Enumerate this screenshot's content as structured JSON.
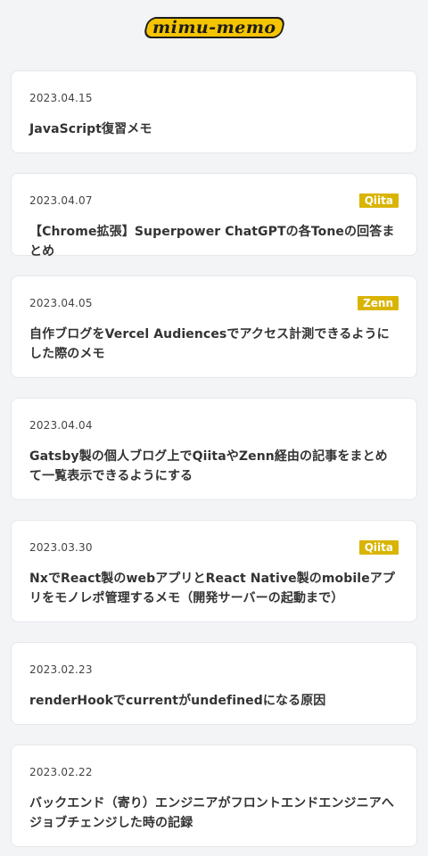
{
  "header": {
    "logo_text": "mimu-memo"
  },
  "posts": [
    {
      "date": "2023.04.15",
      "source": "",
      "title": "JavaScript復習メモ"
    },
    {
      "date": "2023.04.07",
      "source": "Qiita",
      "title": "【Chrome拡張】Superpower ChatGPTの各Toneの回答まとめ"
    },
    {
      "date": "2023.04.05",
      "source": "Zenn",
      "title": "自作ブログをVercel Audiencesでアクセス計測できるようにした際のメモ"
    },
    {
      "date": "2023.04.04",
      "source": "",
      "title": "Gatsby製の個人ブログ上でQiitaやZenn経由の記事をまとめて一覧表示できるようにする"
    },
    {
      "date": "2023.03.30",
      "source": "Qiita",
      "title": "NxでReact製のwebアプリとReact Native製のmobileアプリをモノレポ管理するメモ（開発サーバーの起動まで）"
    },
    {
      "date": "2023.02.23",
      "source": "",
      "title": "renderHookでcurrentがundefinedになる原因"
    },
    {
      "date": "2023.02.22",
      "source": "",
      "title": "バックエンド（寄り）エンジニアがフロントエンドエンジニアへジョブチェンジした時の記録"
    }
  ],
  "colors": {
    "background": "#f3f4f6",
    "card": "#ffffff",
    "badge": "#d9b400",
    "logo_fill": "#f5c400"
  }
}
